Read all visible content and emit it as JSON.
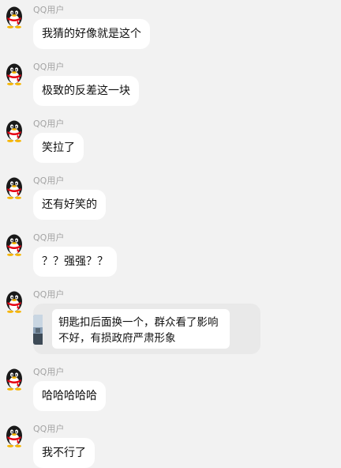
{
  "messages": [
    {
      "sender": "QQ用户",
      "text": "我猜的好像就是这个"
    },
    {
      "sender": "QQ用户",
      "text": "极致的反差这一块"
    },
    {
      "sender": "QQ用户",
      "text": "笑拉了"
    },
    {
      "sender": "QQ用户",
      "text": "还有好笑的"
    },
    {
      "sender": "QQ用户",
      "text": "？？强强？？"
    },
    {
      "sender": "QQ用户",
      "reply_text": "钥匙扣后面换一个，群众看了影响不好，有损政府严肃形象"
    },
    {
      "sender": "QQ用户",
      "text": "哈哈哈哈哈"
    },
    {
      "sender": "QQ用户",
      "text": "我不行了"
    }
  ],
  "icons": {
    "avatar": "qq-penguin-avatar-icon",
    "reply_thumbnail": "image-thumbnail"
  },
  "colors": {
    "background": "#f2f2f2",
    "bubble": "#ffffff",
    "reply_container": "#e9e9e9",
    "sender_text": "#a3a3a3"
  }
}
